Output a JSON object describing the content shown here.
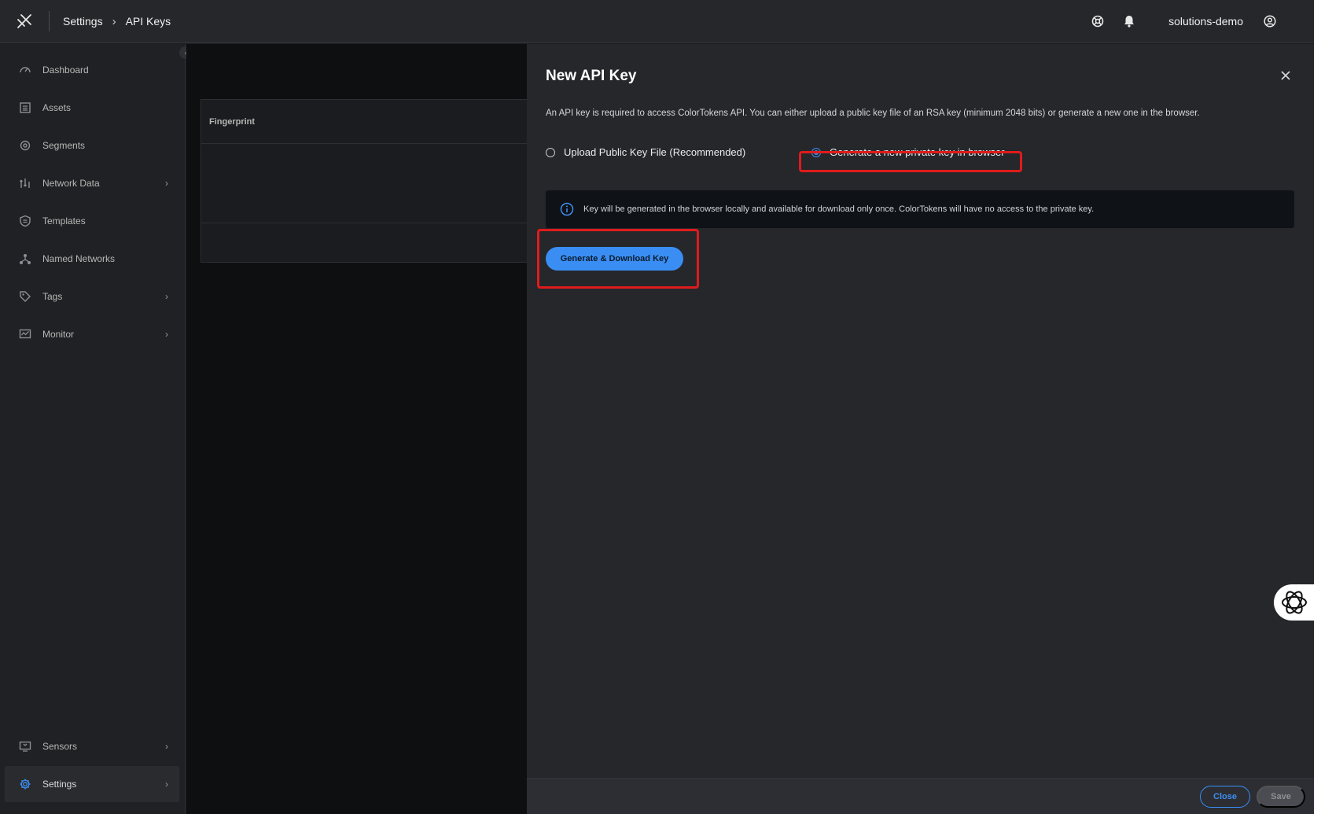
{
  "header": {
    "breadcrumb": [
      "Settings",
      "API Keys"
    ],
    "separator": "›",
    "username": "solutions-demo",
    "icons": [
      "help-icon",
      "bell-icon",
      "account-icon"
    ]
  },
  "sidebar": {
    "items": [
      {
        "label": "Dashboard",
        "icon": "dashboard-icon"
      },
      {
        "label": "Assets",
        "icon": "assets-icon"
      },
      {
        "label": "Segments",
        "icon": "segments-icon"
      },
      {
        "label": "Network Data",
        "icon": "network-data-icon",
        "expandable": true
      },
      {
        "label": "Templates",
        "icon": "templates-icon"
      },
      {
        "label": "Named Networks",
        "icon": "named-networks-icon"
      },
      {
        "label": "Tags",
        "icon": "tags-icon",
        "expandable": true
      },
      {
        "label": "Monitor",
        "icon": "monitor-icon",
        "expandable": true
      },
      {
        "label": "Sensors",
        "icon": "sensors-icon",
        "expandable": true
      },
      {
        "label": "Settings",
        "icon": "settings-icon",
        "expandable": true,
        "active": true
      }
    ]
  },
  "table": {
    "column_header": "Fingerprint"
  },
  "drawer": {
    "title": "New API Key",
    "description": "An API key is required to access ColorTokens API. You can either upload a public key file of an RSA key (minimum 2048 bits) or generate a new one in the browser.",
    "options": [
      {
        "label": "Upload Public Key File (Recommended)",
        "selected": false
      },
      {
        "label": "Generate a new private key in browser",
        "selected": true
      }
    ],
    "info": "Key will be generated in the browser locally and available for download only once. ColorTokens will have no access to the private key.",
    "generate_button": "Generate & Download Key",
    "footer": {
      "close_label": "Close",
      "save_label": "Save"
    }
  },
  "colors": {
    "accent": "#3a8ef3",
    "highlight": "#e01b1b"
  }
}
